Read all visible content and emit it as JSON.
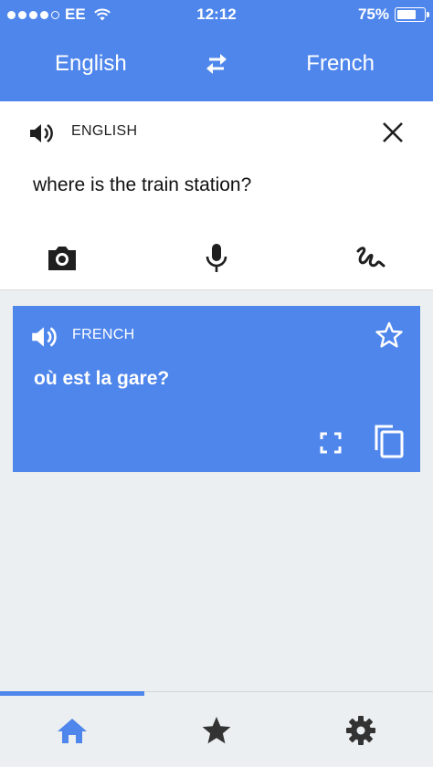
{
  "status_bar": {
    "carrier": "EE",
    "time": "12:12",
    "battery": "75%",
    "battery_level": 0.75,
    "signal_bars_filled": 4,
    "signal_bars_total": 5
  },
  "header": {
    "source_language": "English",
    "target_language": "French",
    "swap_icon": "swap-arrows-icon"
  },
  "input": {
    "language_label": "ENGLISH",
    "text": "where is the train station?",
    "tools": [
      "camera-icon",
      "microphone-icon",
      "handwriting-icon"
    ]
  },
  "result": {
    "language_label": "FRENCH",
    "text": "où est la gare?"
  },
  "bottom_nav": {
    "items": [
      "home-icon",
      "star-icon",
      "settings-icon"
    ],
    "active": "home"
  },
  "colors": {
    "accent": "#4f86ec",
    "background": "#eceff1",
    "card": "#ffffff"
  }
}
